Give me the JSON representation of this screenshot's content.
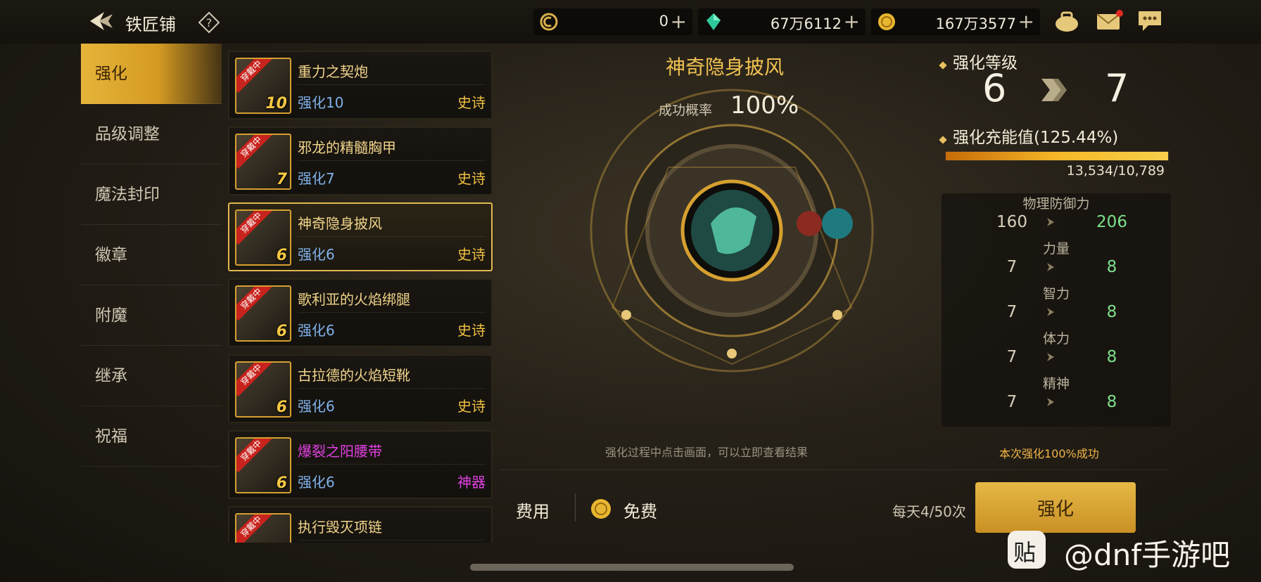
{
  "header": {
    "title": "铁匠铺",
    "help_glyph": "?",
    "currencies": [
      {
        "icon": "ticket-icon",
        "value": "0"
      },
      {
        "icon": "gem-icon",
        "value": "67万6112"
      },
      {
        "icon": "gold-coin-icon",
        "value": "167万3577"
      }
    ],
    "plus_glyph": "+",
    "icons": [
      "bag-icon",
      "mail-icon",
      "chat-icon"
    ]
  },
  "sidebar": {
    "items": [
      {
        "label": "强化",
        "active": true
      },
      {
        "label": "品级调整"
      },
      {
        "label": "魔法封印"
      },
      {
        "label": "徽章"
      },
      {
        "label": "附魔"
      },
      {
        "label": "继承"
      },
      {
        "label": "祝福"
      }
    ]
  },
  "equipment_list": [
    {
      "tag": "穿戴中",
      "level": "10",
      "name": "重力之契炮",
      "enhance": "强化10",
      "rarity": "史诗",
      "rarity_color": "#f0c040",
      "name_color": "#f0d48a"
    },
    {
      "tag": "穿戴中",
      "level": "7",
      "name": "邪龙的精髓胸甲",
      "enhance": "强化7",
      "rarity": "史诗",
      "rarity_color": "#f0c040",
      "name_color": "#f0d48a"
    },
    {
      "tag": "穿戴中",
      "level": "6",
      "name": "神奇隐身披风",
      "enhance": "强化6",
      "rarity": "史诗",
      "rarity_color": "#f0c040",
      "name_color": "#f0d48a",
      "selected": true
    },
    {
      "tag": "穿戴中",
      "level": "6",
      "name": "歌利亚的火焰绑腿",
      "enhance": "强化6",
      "rarity": "史诗",
      "rarity_color": "#f0c040",
      "name_color": "#f0d48a"
    },
    {
      "tag": "穿戴中",
      "level": "6",
      "name": "古拉德的火焰短靴",
      "enhance": "强化6",
      "rarity": "史诗",
      "rarity_color": "#f0c040",
      "name_color": "#f0d48a"
    },
    {
      "tag": "穿戴中",
      "level": "6",
      "name": "爆裂之阳腰带",
      "enhance": "强化6",
      "rarity": "神器",
      "rarity_color": "#e040e0",
      "name_color": "#e040e0"
    },
    {
      "tag": "穿戴中",
      "level": "",
      "name": "执行毁灭项链",
      "enhance": "",
      "rarity": "",
      "rarity_color": "#f0c040",
      "name_color": "#f0d48a"
    }
  ],
  "center": {
    "item_name": "神奇隐身披风",
    "rate_label": "成功概率",
    "rate_value": "100%",
    "hint": "强化过程中点击画面，可以立即查看结果"
  },
  "enhance_panel": {
    "level_label": "强化等级",
    "level_from": "6",
    "level_to": "7",
    "charge_label": "强化充能值(125.44%)",
    "charge_fill": 1.0,
    "charge_ratio": "13,534/10,789",
    "stats": [
      {
        "name": "物理防御力",
        "from": "160",
        "to": "206"
      },
      {
        "name": "力量",
        "from": "7",
        "to": "8"
      },
      {
        "name": "智力",
        "from": "7",
        "to": "8"
      },
      {
        "name": "体力",
        "from": "7",
        "to": "8"
      },
      {
        "name": "精神",
        "from": "7",
        "to": "8"
      }
    ],
    "success_note": "本次强化100%成功"
  },
  "footer": {
    "fee_label": "费用",
    "fee_value": "免费",
    "daily_count": "每天4/50次",
    "enhance_button": "强化"
  },
  "watermark": {
    "icon_glyph": "贴",
    "text": "@dnf手游吧"
  }
}
